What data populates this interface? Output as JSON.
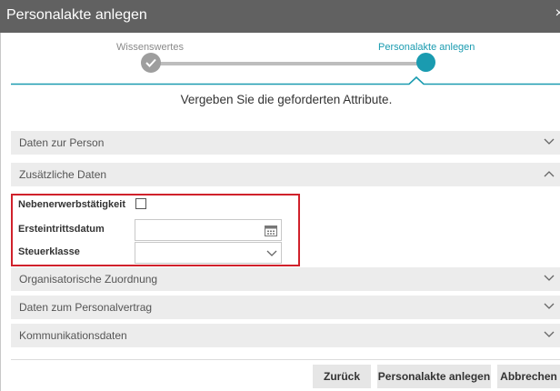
{
  "dialog": {
    "title": "Personalakte anlegen",
    "close_glyph": "×"
  },
  "stepper": {
    "steps": [
      {
        "label": "Wissenswertes",
        "state": "done"
      },
      {
        "label": "Personalakte anlegen",
        "state": "current"
      }
    ],
    "accent_color": "#1a9bb0"
  },
  "instruction": "Vergeben Sie die geforderten Attribute.",
  "sections": [
    {
      "label": "Daten zur Person",
      "expanded": false
    },
    {
      "label": "Zusätzliche Daten",
      "expanded": true
    },
    {
      "label": "Organisatorische Zuordnung",
      "expanded": false
    },
    {
      "label": "Daten zum Personalvertrag",
      "expanded": false
    },
    {
      "label": "Kommunikationsdaten",
      "expanded": false
    }
  ],
  "fields": {
    "nebenerwerb": {
      "label": "Nebenerwerbstätigkeit",
      "checked": false
    },
    "ersteintritt": {
      "label": "Ersteintrittsdatum",
      "value": ""
    },
    "steuerklasse": {
      "label": "Steuerklasse",
      "value": ""
    }
  },
  "buttons": {
    "back": "Zurück",
    "create": "Personalakte anlegen",
    "cancel": "Abbrechen"
  }
}
